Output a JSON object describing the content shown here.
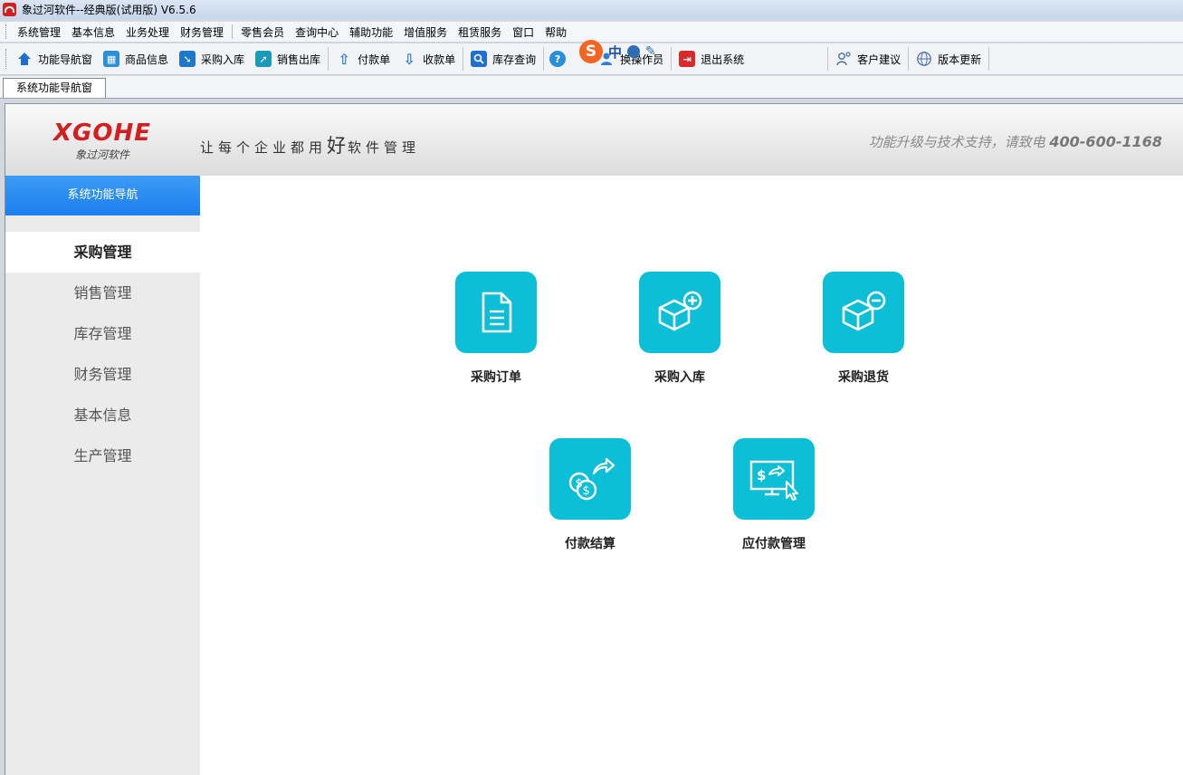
{
  "window": {
    "title": "象过河软件--经典版(试用版) V6.5.6"
  },
  "menu": {
    "group1": [
      "系统管理",
      "基本信息",
      "业务处理",
      "财务管理"
    ],
    "group2": [
      "零售会员",
      "查询中心",
      "辅助功能",
      "增值服务",
      "租赁服务",
      "窗口",
      "帮助"
    ]
  },
  "toolbar": {
    "items": [
      {
        "label": "功能导航窗",
        "icon": "home-icon",
        "color": "#1f6fd1"
      },
      {
        "label": "商品信息",
        "icon": "product-info-icon",
        "color": "#2b8fd6"
      },
      {
        "label": "采购入库",
        "icon": "purchase-in-icon",
        "color": "#1f77c9"
      },
      {
        "label": "销售出库",
        "icon": "sale-out-icon",
        "color": "#1a9ab9"
      },
      {
        "label": "付款单",
        "icon": "payment-up-icon",
        "color": "#2e7fd1"
      },
      {
        "label": "收款单",
        "icon": "receipt-down-icon",
        "color": "#2e7fd1"
      },
      {
        "label": "库存查询",
        "icon": "search-icon",
        "color": "#1f6fd1"
      },
      {
        "label": "换操作员",
        "icon": "switch-operator-icon",
        "color": "#2e7fd1"
      },
      {
        "label": "退出系统",
        "icon": "exit-icon",
        "color": "#d62b2b"
      },
      {
        "label": "客户建议",
        "icon": "user-suggestion-icon",
        "color": "#4a6fa8"
      },
      {
        "label": "版本更新",
        "icon": "globe-update-icon",
        "color": "#4a6fa8"
      }
    ]
  },
  "ime": {
    "lang": "中"
  },
  "tabs": [
    {
      "label": "系统功能导航窗"
    }
  ],
  "banner": {
    "brand": "XGOHE",
    "brand_sub": "象过河软件",
    "slogan_before": "让每个企业都用",
    "slogan_emph": "好",
    "slogan_after": "软件管理",
    "support_text": "功能升级与技术支持，请致电",
    "support_phone": "400-600-1168"
  },
  "sidebar": {
    "header": "系统功能导航",
    "items": [
      {
        "label": "采购管理",
        "active": true
      },
      {
        "label": "销售管理",
        "active": false
      },
      {
        "label": "库存管理",
        "active": false
      },
      {
        "label": "财务管理",
        "active": false
      },
      {
        "label": "基本信息",
        "active": false
      },
      {
        "label": "生产管理",
        "active": false
      }
    ]
  },
  "tiles": {
    "accent": "#0cbfd6",
    "items": [
      {
        "label": "采购订单",
        "icon": "document-icon"
      },
      {
        "label": "采购入库",
        "icon": "box-add-icon"
      },
      {
        "label": "采购退货",
        "icon": "box-remove-icon"
      },
      {
        "label": "付款结算",
        "icon": "coins-transfer-icon"
      },
      {
        "label": "应付款管理",
        "icon": "monitor-payment-icon"
      }
    ]
  }
}
